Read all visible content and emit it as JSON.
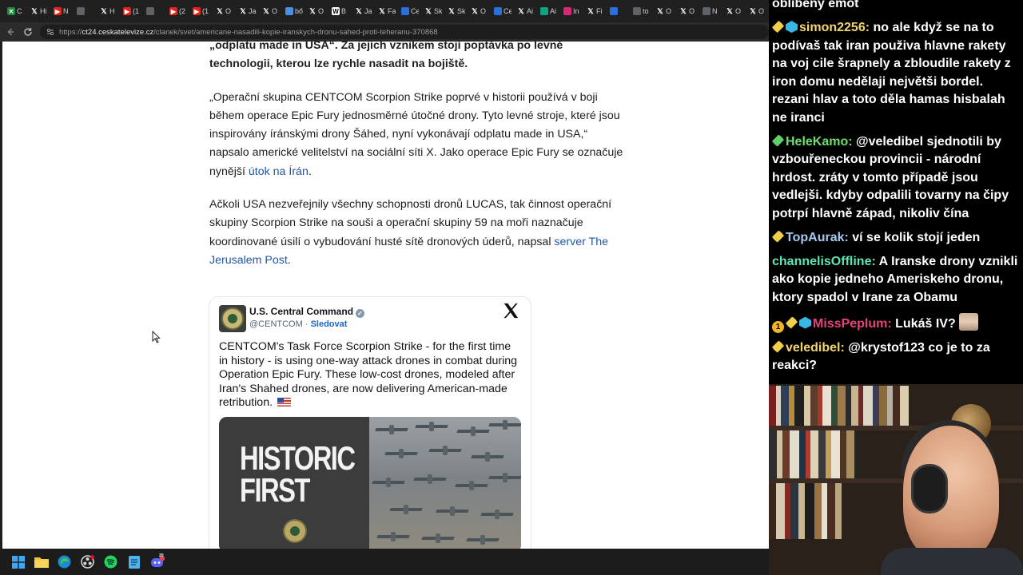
{
  "browser": {
    "tabs": [
      {
        "icon": "green-x",
        "label": "C",
        "color": "#1e8e3e"
      },
      {
        "icon": "x",
        "label": "Hi",
        "color": ""
      },
      {
        "icon": "youtube",
        "label": "N",
        "color": "#e62117"
      },
      {
        "icon": "tab",
        "label": "",
        "color": "#5f6368"
      },
      {
        "icon": "x",
        "label": "H",
        "color": ""
      },
      {
        "icon": "youtube",
        "label": "(1",
        "color": "#e62117"
      },
      {
        "icon": "tab",
        "label": "",
        "color": "#5f6368"
      },
      {
        "icon": "youtube",
        "label": "(2",
        "color": "#e62117"
      },
      {
        "icon": "youtube",
        "label": "(1",
        "color": "#e62117"
      },
      {
        "icon": "x",
        "label": "O",
        "color": ""
      },
      {
        "icon": "x",
        "label": "Ja",
        "color": ""
      },
      {
        "icon": "x",
        "label": "O",
        "color": ""
      },
      {
        "icon": "search",
        "label": "bő",
        "color": "#4a90e2"
      },
      {
        "icon": "x",
        "label": "O",
        "color": ""
      },
      {
        "icon": "wiki",
        "label": "B",
        "color": "#ffffff"
      },
      {
        "icon": "x",
        "label": "Ja",
        "color": ""
      },
      {
        "icon": "x",
        "label": "Fa",
        "color": ""
      },
      {
        "icon": "ct",
        "label": "Ce",
        "color": "#2a6fdb"
      },
      {
        "icon": "x",
        "label": "Sk",
        "color": ""
      },
      {
        "icon": "x",
        "label": "Sk",
        "color": ""
      },
      {
        "icon": "x",
        "label": "O",
        "color": ""
      },
      {
        "icon": "ct",
        "label": "Ce",
        "color": "#2a6fdb"
      },
      {
        "icon": "x",
        "label": "Ai",
        "color": ""
      },
      {
        "icon": "green",
        "label": "Ai",
        "color": "#10a37f"
      },
      {
        "icon": "instagram",
        "label": "In",
        "color": "#d62976"
      },
      {
        "icon": "x",
        "label": "Fi",
        "color": ""
      },
      {
        "icon": "ct",
        "label": "",
        "color": "#2a6fdb"
      },
      {
        "icon": "tab",
        "label": "to",
        "color": "#5f6368"
      },
      {
        "icon": "x",
        "label": "O",
        "color": ""
      },
      {
        "icon": "x",
        "label": "O",
        "color": ""
      },
      {
        "icon": "news",
        "label": "N",
        "color": "#5f6368"
      },
      {
        "icon": "x",
        "label": "O",
        "color": ""
      },
      {
        "icon": "x",
        "label": "O",
        "color": ""
      }
    ],
    "url": {
      "prefix": "https://",
      "host": "ct24.ceskatelevize.cz",
      "path": "/clanek/svet/americane-nasadili-kopie-iranskych-dronu-sahed-proti-teheranu-370868"
    }
  },
  "article": {
    "p0": "„odplatu made in USA“. Za jejich vznikem stojí poptávka po levné technologii, kterou lze rychle nasadit na bojiště.",
    "p1_text": "„Operační skupina CENTCOM Scorpion Strike poprvé v historii používá v boji během operace Epic Fury jednosměrné útočné drony. Tyto levné stroje, které jsou inspirovány íránskými drony Šáhed, nyní vykonávají odplatu made in USA,“ napsalo americké velitelství na sociální síti X. Jako operace Epic Fury se označuje nynější ",
    "p1_link": "útok na Írán",
    "p1_end": ".",
    "p2_text": "Ačkoli USA nezveřejnily všechny schopnosti dronů LUCAS, tak činnost operační skupiny Scorpion Strike na souši a operační skupiny 59 na moři naznačuje koordinované úsilí o vybudování husté sítě dronových úderů, napsal ",
    "p2_link": "server The Jerusalem Post",
    "p2_end": "."
  },
  "tweet": {
    "name": "U.S. Central Command",
    "handle": "@CENTCOM",
    "separator": "·",
    "follow": "Sledovat",
    "text": "CENTCOM's Task Force Scorpion Strike - for the first time in history - is using one-way attack drones in combat during Operation Epic Fury. These low-cost drones, modeled after Iran's Shahed drones, are now delivering American-made retribution.",
    "image_text_line1": "HISTORIC",
    "image_text_line2": "FIRST"
  },
  "chat": {
    "messages": [
      {
        "badges": [],
        "user": "",
        "user_color": "#ffffff",
        "text": "oblíbený emot"
      },
      {
        "badges": [
          "pill",
          "gem"
        ],
        "user": "simon2256",
        "user_color": "#f3d66b",
        "text": "no ale když se na to podívaš tak iran použiva hlavne rakety na voj cile šrapnely a zbloudile rakety z iron domu nedělaji největši bordel. rezani hlav a toto děla hamas hisbalah ne iranci"
      },
      {
        "badges": [
          "pill-green"
        ],
        "user": "HeleKamo",
        "user_color": "#70df70",
        "text": "@veledibel sjednotili by vzbouřeneckou provincii - národní hrdost. zráty v tomto případě jsou vedlejši. kdyby odpalili tovarny na čipy potrpí hlavně západ, nikoliv čína"
      },
      {
        "badges": [
          "pill"
        ],
        "user": "TopAurak",
        "user_color": "#a9c8f0",
        "text": "ví se kolik stojí jeden"
      },
      {
        "badges": [],
        "user": "channelisOffline",
        "user_color": "#5de5b4",
        "text": "A Iranske drony vznikli ako kopie jedneho Ameriskeho dronu, ktory spadol v Irane za Obamu"
      },
      {
        "badges": [
          "coin",
          "pill",
          "gem"
        ],
        "user": "MissPeplum",
        "user_color": "#e8427d",
        "text": "Lukáš IV?"
      },
      {
        "badges": [
          "pill"
        ],
        "user": "veledibel",
        "user_color": "#f3d66b",
        "text": "@krystof123 co je to za reakci?"
      }
    ]
  },
  "taskbar": {
    "apps": [
      "windows-start",
      "file-explorer",
      "edge-browser",
      "obs",
      "spotify",
      "notepad",
      "discord"
    ],
    "discord_badge": "20"
  },
  "colors": {
    "link": "#1f56a8",
    "chat_bg": "#000000",
    "taskbar_bg": "#1c1c1c"
  }
}
